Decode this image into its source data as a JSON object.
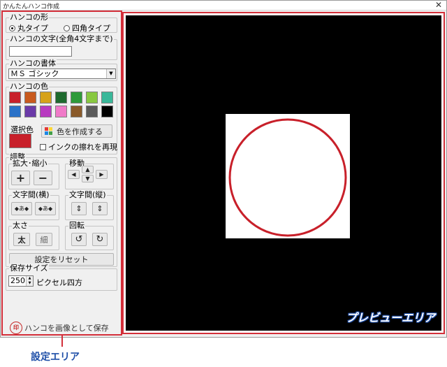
{
  "window": {
    "title": "かんたんハンコ作成",
    "close_glyph": "✕"
  },
  "shape_group": {
    "legend": "ハンコの形",
    "options": [
      {
        "label": "丸タイプ",
        "selected": true
      },
      {
        "label": "四角タイプ",
        "selected": false
      }
    ]
  },
  "text_group": {
    "legend": "ハンコの文字(全角4文字まで)",
    "value": ""
  },
  "font_group": {
    "legend": "ハンコの書体",
    "selected": "ＭＳ ゴシック",
    "arrow": "▼"
  },
  "color_group": {
    "legend": "ハンコの色",
    "palette": [
      "#c8202a",
      "#c85a1e",
      "#d6a21a",
      "#1e6a2e",
      "#2e9a3a",
      "#88c840",
      "#3ab89a",
      "#2a72c8",
      "#6a3aa8",
      "#b83ac0",
      "#f07ac8",
      "#8a5a2a",
      "#5a5a5a",
      "#000000"
    ],
    "selected_label": "選択色",
    "selected_color": "#c8202a",
    "make_color_button": "色を作成する",
    "ink_blur_checkbox": "インクの擦れを再現"
  },
  "adjust_group": {
    "legend": "調整",
    "zoom": {
      "legend": "拡大･縮小",
      "plus": "+",
      "minus": "−"
    },
    "move": {
      "legend": "移動",
      "up": "▲",
      "down": "▼",
      "left": "◀",
      "right": "▶"
    },
    "char_spacing_h": {
      "legend": "文字間(横)",
      "narrow": "◆あ◆",
      "wide": "◆あ◆"
    },
    "char_spacing_v": {
      "legend": "文字間(縦)",
      "narrow": "⇕",
      "wide": "⇕"
    },
    "weight": {
      "legend": "太さ",
      "bold": "太",
      "thin": "細"
    },
    "rotate": {
      "legend": "回転",
      "ccw": "↺",
      "cw": "↻"
    },
    "reset_button": "設定をリセット"
  },
  "size_group": {
    "legend": "保存サイズ",
    "value": "250",
    "unit": "ピクセル四方"
  },
  "save": {
    "label": "ハンコを画像として保存",
    "icon_text": "印"
  },
  "preview": {
    "label": "プレビューエリア",
    "stamp_color": "#c8202a"
  },
  "annotation": {
    "settings_label": "設定エリア"
  }
}
